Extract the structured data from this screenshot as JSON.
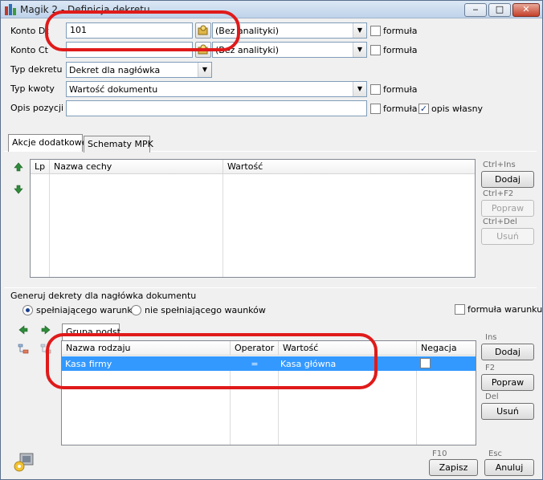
{
  "window": {
    "title": "Magik 2 - Definicja dekretu",
    "buttons": {
      "minimize": "‒",
      "maximize": "□",
      "close": "✕"
    }
  },
  "form": {
    "konto_dt": {
      "label": "Konto Dt",
      "value": "101",
      "analytics": "(Bez analityki)",
      "formula_label": "formuła"
    },
    "konto_ct": {
      "label": "Konto Ct",
      "value": "",
      "analytics": "(Bez analityki)",
      "formula_label": "formuła"
    },
    "typ_dekretu": {
      "label": "Typ dekretu",
      "value": "Dekret dla nagłówka"
    },
    "typ_kwoty": {
      "label": "Typ kwoty",
      "value": "Wartość dokumentu",
      "formula_label": "formuła"
    },
    "opis_pozycji": {
      "label": "Opis pozycji",
      "value": "",
      "formula_label": "formuła",
      "opis_wlasny_label": "opis własny",
      "opis_wlasny_checked": true
    }
  },
  "tabs": [
    {
      "label": "Akcje dodatkowe",
      "active": true
    },
    {
      "label": "Schematy MPK",
      "active": false
    }
  ],
  "attr_grid": {
    "columns": [
      "Lp",
      "Nazwa cechy",
      "Wartość"
    ],
    "rows": []
  },
  "attr_actions": {
    "add": {
      "hotkey": "Ctrl+Ins",
      "label": "Dodaj"
    },
    "edit": {
      "hotkey": "Ctrl+F2",
      "label": "Popraw"
    },
    "delete": {
      "hotkey": "Ctrl+Del",
      "label": "Usuń"
    }
  },
  "generate": {
    "group_label": "Generuj dekrety dla nagłówka dokumentu",
    "radio_meeting": "spełniającego warunki",
    "radio_not_meeting": "nie spełniającego waunków",
    "selected": "meeting",
    "formula_warunku": "formuła warunku"
  },
  "conditions": {
    "group_tab": "Grupa podst.",
    "columns": [
      "Nazwa rodzaju",
      "Operator",
      "Wartość",
      "Negacja"
    ],
    "rows": [
      {
        "nazwa": "Kasa firmy",
        "operator": "=",
        "wartosc": "Kasa główna",
        "negacja": false
      }
    ]
  },
  "cond_actions": {
    "add": {
      "hotkey": "Ins",
      "label": "Dodaj"
    },
    "edit": {
      "hotkey": "F2",
      "label": "Popraw"
    },
    "delete": {
      "hotkey": "Del",
      "label": "Usuń"
    }
  },
  "footer": {
    "save": {
      "hotkey": "F10",
      "label": "Zapisz"
    },
    "cancel": {
      "hotkey": "Esc",
      "label": "Anuluj"
    }
  },
  "colors": {
    "selection": "#3399ff",
    "annotation": "#e01a1a"
  },
  "icons": [
    "app-icon",
    "lookup-icon",
    "arrow-up-icon",
    "arrow-down-icon",
    "arrow-left-icon",
    "arrow-right-icon",
    "tree-icon",
    "settings-key-icon",
    "chevron-down-icon"
  ]
}
